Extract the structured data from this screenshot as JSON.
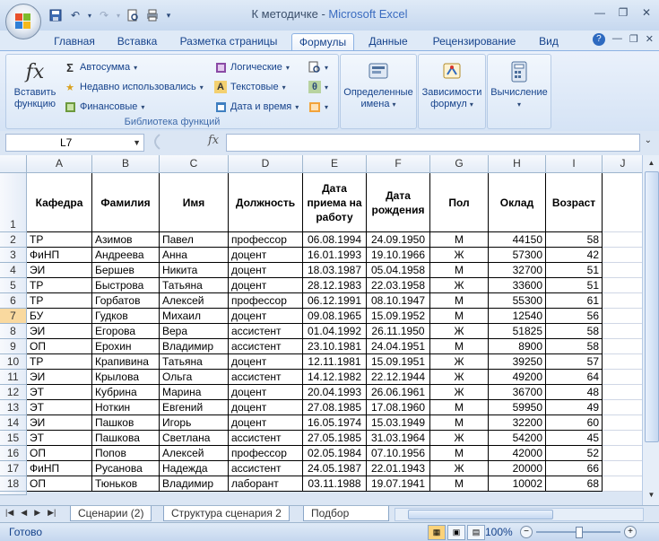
{
  "window": {
    "title_doc": "К методичке",
    "title_sep": " - ",
    "title_app": "Microsoft Excel"
  },
  "tabs": [
    "Главная",
    "Вставка",
    "Разметка страницы",
    "Формулы",
    "Данные",
    "Рецензирование",
    "Вид"
  ],
  "active_tab": "Формулы",
  "ribbon": {
    "insert_function_line1": "Вставить",
    "insert_function_line2": "функцию",
    "autosum": "Автосумма",
    "recently_used": "Недавно использовались",
    "financial": "Финансовые",
    "logical": "Логические",
    "text": "Текстовые",
    "datetime": "Дата и время",
    "group_library": "Библиотека функций",
    "defined_names_1": "Определенные",
    "defined_names_2": "имена",
    "formula_auditing_1": "Зависимости",
    "formula_auditing_2": "формул",
    "calculation": "Вычисление"
  },
  "formula_bar": {
    "name_box": "L7",
    "fx_label": "fx",
    "formula": ""
  },
  "columns": [
    "A",
    "B",
    "C",
    "D",
    "E",
    "F",
    "G",
    "H",
    "I",
    "J"
  ],
  "header_row": {
    "row_number": "1",
    "cells": [
      "Кафедра",
      "Фамилия",
      "Имя",
      "Должность",
      "Дата приема на работу",
      "Дата рождения",
      "Пол",
      "Оклад",
      "Возраст"
    ]
  },
  "rows": [
    {
      "n": "2",
      "dept": "ТР",
      "last": "Азимов",
      "first": "Павел",
      "pos": "профессор",
      "hired": "06.08.1994",
      "born": "24.09.1950",
      "sex": "М",
      "salary": "44150",
      "age": "58"
    },
    {
      "n": "3",
      "dept": "ФиНП",
      "last": "Андреева",
      "first": "Анна",
      "pos": "доцент",
      "hired": "16.01.1993",
      "born": "19.10.1966",
      "sex": "Ж",
      "salary": "57300",
      "age": "42"
    },
    {
      "n": "4",
      "dept": "ЭИ",
      "last": "Бершев",
      "first": "Никита",
      "pos": "доцент",
      "hired": "18.03.1987",
      "born": "05.04.1958",
      "sex": "М",
      "salary": "32700",
      "age": "51"
    },
    {
      "n": "5",
      "dept": "ТР",
      "last": "Быстрова",
      "first": "Татьяна",
      "pos": "доцент",
      "hired": "28.12.1983",
      "born": "22.03.1958",
      "sex": "Ж",
      "salary": "33600",
      "age": "51"
    },
    {
      "n": "6",
      "dept": "ТР",
      "last": "Горбатов",
      "first": "Алексей",
      "pos": "профессор",
      "hired": "06.12.1991",
      "born": "08.10.1947",
      "sex": "М",
      "salary": "55300",
      "age": "61"
    },
    {
      "n": "7",
      "dept": "БУ",
      "last": "Гудков",
      "first": "Михаил",
      "pos": "доцент",
      "hired": "09.08.1965",
      "born": "15.09.1952",
      "sex": "М",
      "salary": "12540",
      "age": "56"
    },
    {
      "n": "8",
      "dept": "ЭИ",
      "last": "Егорова",
      "first": "Вера",
      "pos": "ассистент",
      "hired": "01.04.1992",
      "born": "26.11.1950",
      "sex": "Ж",
      "salary": "51825",
      "age": "58"
    },
    {
      "n": "9",
      "dept": "ОП",
      "last": "Ерохин",
      "first": "Владимир",
      "pos": "ассистент",
      "hired": "23.10.1981",
      "born": "24.04.1951",
      "sex": "М",
      "salary": "8900",
      "age": "58"
    },
    {
      "n": "10",
      "dept": "ТР",
      "last": "Крапивина",
      "first": "Татьяна",
      "pos": "доцент",
      "hired": "12.11.1981",
      "born": "15.09.1951",
      "sex": "Ж",
      "salary": "39250",
      "age": "57"
    },
    {
      "n": "11",
      "dept": "ЭИ",
      "last": "Крылова",
      "first": "Ольга",
      "pos": "ассистент",
      "hired": "14.12.1982",
      "born": "22.12.1944",
      "sex": "Ж",
      "salary": "49200",
      "age": "64"
    },
    {
      "n": "12",
      "dept": "ЭТ",
      "last": "Кубрина",
      "first": "Марина",
      "pos": "доцент",
      "hired": "20.04.1993",
      "born": "26.06.1961",
      "sex": "Ж",
      "salary": "36700",
      "age": "48"
    },
    {
      "n": "13",
      "dept": "ЭТ",
      "last": "Ноткин",
      "first": "Евгений",
      "pos": "доцент",
      "hired": "27.08.1985",
      "born": "17.08.1960",
      "sex": "М",
      "salary": "59950",
      "age": "49"
    },
    {
      "n": "14",
      "dept": "ЭИ",
      "last": "Пашков",
      "first": "Игорь",
      "pos": "доцент",
      "hired": "16.05.1974",
      "born": "15.03.1949",
      "sex": "М",
      "salary": "32200",
      "age": "60"
    },
    {
      "n": "15",
      "dept": "ЭТ",
      "last": "Пашкова",
      "first": "Светлана",
      "pos": "ассистент",
      "hired": "27.05.1985",
      "born": "31.03.1964",
      "sex": "Ж",
      "salary": "54200",
      "age": "45"
    },
    {
      "n": "16",
      "dept": "ОП",
      "last": "Попов",
      "first": "Алексей",
      "pos": "профессор",
      "hired": "02.05.1984",
      "born": "07.10.1956",
      "sex": "М",
      "salary": "42000",
      "age": "52"
    },
    {
      "n": "17",
      "dept": "ФиНП",
      "last": "Русанова",
      "first": "Надежда",
      "pos": "ассистент",
      "hired": "24.05.1987",
      "born": "22.01.1943",
      "sex": "Ж",
      "salary": "20000",
      "age": "66"
    },
    {
      "n": "18",
      "dept": "ОП",
      "last": "Тюньков",
      "first": "Владимир",
      "pos": "лаборант",
      "hired": "03.11.1988",
      "born": "19.07.1941",
      "sex": "М",
      "salary": "10002",
      "age": "68"
    }
  ],
  "selected_row": "7",
  "sheet_tabs": [
    "Сценарии (2)",
    "Структура сценария 2",
    "Подбор парам"
  ],
  "status": {
    "ready": "Готово",
    "zoom": "100%",
    "zoom_level_pct": 100
  },
  "icons": {
    "office": "office-logo",
    "save": "save-icon",
    "undo": "undo-icon",
    "redo": "redo-icon"
  }
}
